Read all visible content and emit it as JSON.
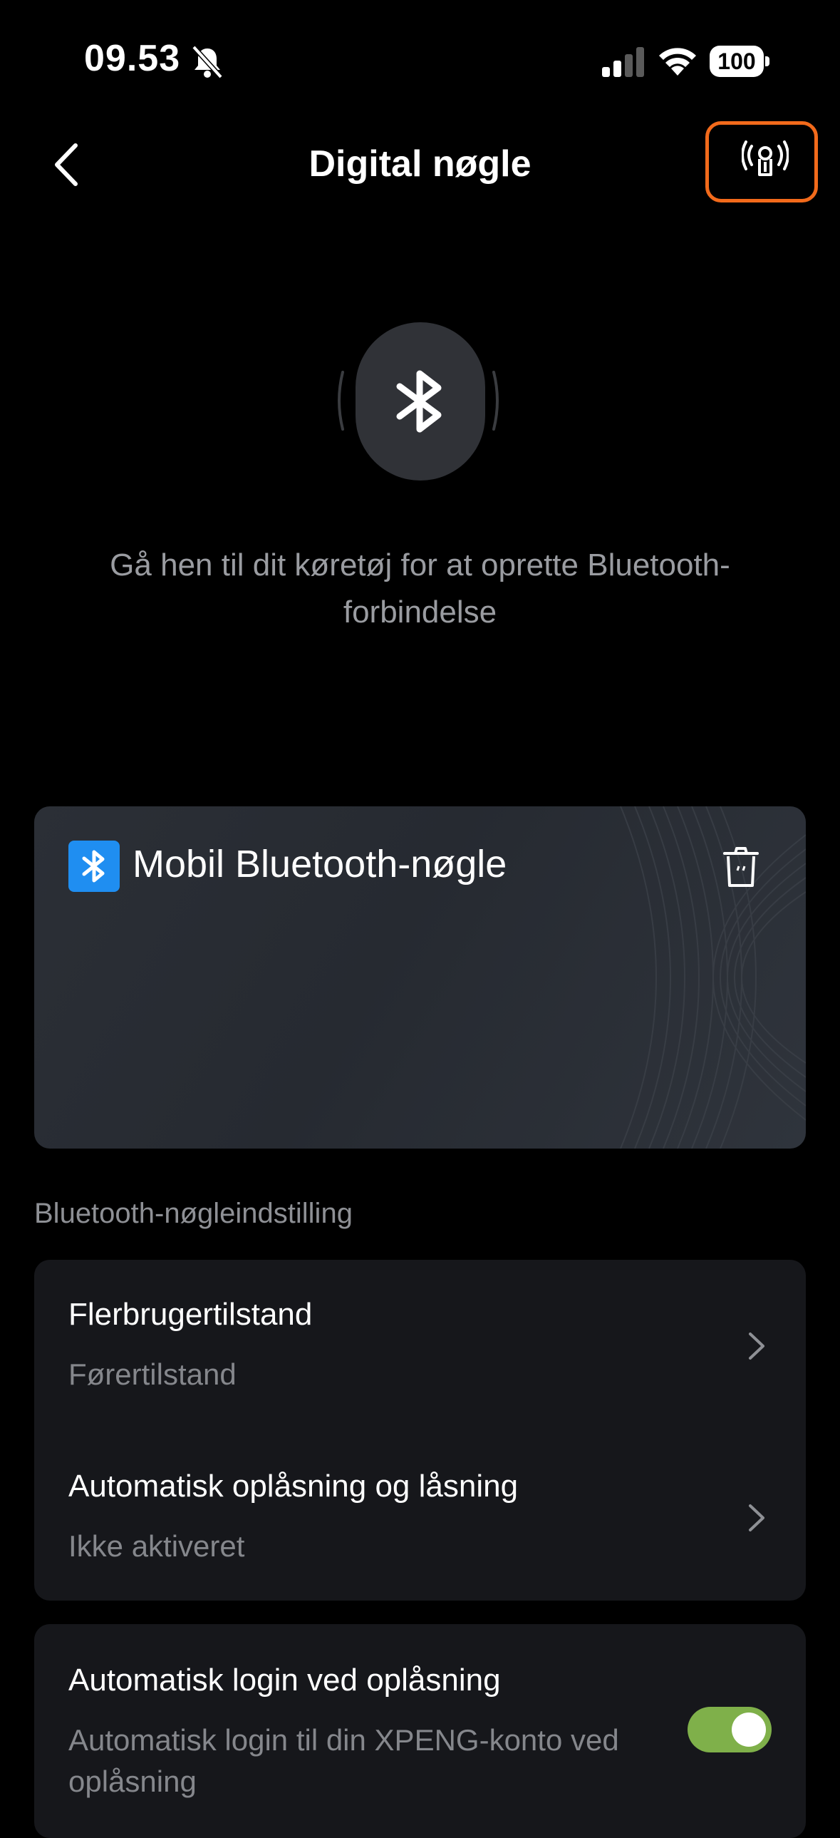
{
  "status_bar": {
    "time": "09.53",
    "battery": "100"
  },
  "nav": {
    "title": "Digital nøgle"
  },
  "hero": {
    "hint": "Gå hen til dit køretøj for at oprette Bluetooth-forbindelse"
  },
  "key_card": {
    "title": "Mobil Bluetooth-nøgle"
  },
  "settings": {
    "section_label": "Bluetooth-nøgleindstilling",
    "rows": [
      {
        "title": "Flerbrugertilstand",
        "value": "Førertilstand"
      },
      {
        "title": "Automatisk oplåsning og låsning",
        "value": "Ikke aktiveret"
      }
    ],
    "auto_login": {
      "title": "Automatisk login ved oplåsning",
      "description": "Automatisk login til din XPENG-konto ved oplåsning",
      "enabled": true
    }
  },
  "colors": {
    "accent_orange": "#f26a1b",
    "bluetooth_blue": "#1f8ef1",
    "toggle_on": "#7fb04a"
  }
}
